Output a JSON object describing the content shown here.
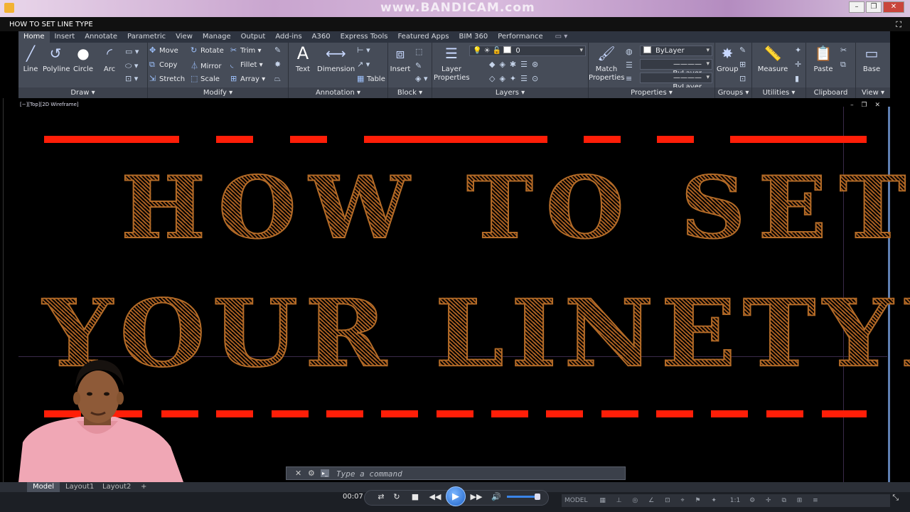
{
  "window": {
    "title": "HOW TO SET LINE TYPE",
    "recorder_watermark": "www.BANDICAM.com",
    "controls": {
      "minimize": "–",
      "restore": "❐",
      "close": "✕"
    }
  },
  "ribbon_tabs": [
    "Home",
    "Insert",
    "Annotate",
    "Parametric",
    "View",
    "Manage",
    "Output",
    "Add-ins",
    "A360",
    "Express Tools",
    "Featured Apps",
    "BIM 360",
    "Performance"
  ],
  "panels": {
    "draw": {
      "title": "Draw",
      "line": "Line",
      "polyline": "Polyline",
      "circle": "Circle",
      "arc": "Arc"
    },
    "modify": {
      "title": "Modify",
      "move": "Move",
      "rotate": "Rotate",
      "trim": "Trim",
      "copy": "Copy",
      "mirror": "Mirror",
      "fillet": "Fillet",
      "stretch": "Stretch",
      "scale": "Scale",
      "array": "Array"
    },
    "annotation": {
      "title": "Annotation",
      "text": "Text",
      "dimension": "Dimension",
      "table": "Table"
    },
    "block": {
      "title": "Block",
      "insert": "Insert"
    },
    "layers": {
      "title": "Layers",
      "layer_properties": "Layer Properties",
      "current_layer": "0"
    },
    "properties": {
      "title": "Properties",
      "match_properties": "Match Properties",
      "color": "ByLayer",
      "linetype": "ByLayer",
      "lineweight": "ByLayer"
    },
    "groups": {
      "title": "Groups",
      "group": "Group"
    },
    "utilities": {
      "title": "Utilities",
      "measure": "Measure"
    },
    "clipboard": {
      "title": "Clipboard",
      "paste": "Paste"
    },
    "view": {
      "title": "View",
      "base": "Base"
    }
  },
  "viewport": {
    "label": "[−][Top][2D Wireframe]",
    "controls": "– ❐ ✕"
  },
  "drawing": {
    "line1": "HOW TO SET",
    "line2": "YOUR LINETYPE",
    "linetype_color": "#ff1e08",
    "text_color": "#b36b27"
  },
  "command_line": {
    "placeholder": "Type a command",
    "close": "✕",
    "wrench": "🔧"
  },
  "layout_tabs": [
    "Model",
    "Layout1",
    "Layout2",
    "+"
  ],
  "player": {
    "time": "00:07"
  },
  "status": {
    "model": "MODEL",
    "scale": "1:1"
  }
}
